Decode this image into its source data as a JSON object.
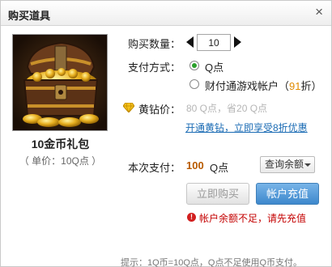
{
  "window": {
    "title": "购买道具",
    "close_glyph": "×"
  },
  "product": {
    "image_icon": "treasure-chest",
    "name": "10金币礼包",
    "unit_price": "（ 单价：10Q点 ）"
  },
  "quantity": {
    "label": "购买数量：",
    "value": "10"
  },
  "payment": {
    "label": "支付方式：",
    "options": [
      {
        "text": "Q点",
        "selected": true
      },
      {
        "text_prefix": "财付通游戏帐户（",
        "discount": "91",
        "text_suffix": "折）",
        "selected": false
      }
    ]
  },
  "vip": {
    "label": "黄钻价：",
    "price_text": "80 Q点，省20 Q点",
    "link": "开通黄钻，立即享受8折优惠"
  },
  "total": {
    "label": "本次支付：",
    "value": "100",
    "unit": "Q点"
  },
  "balance_button": "查询余额",
  "buttons": {
    "buy": "立即购买",
    "recharge": "帐户充值"
  },
  "error": {
    "icon_glyph": "!",
    "text": "帐户余额不足，请先充值"
  },
  "tip": "提示：1Q币=10Q点，Q点不足使用Q币支付。",
  "colors": {
    "accent_blue": "#3d88cc",
    "price_orange": "#b85a00",
    "error_red": "#c40000",
    "radio_green": "#2aa02a"
  }
}
